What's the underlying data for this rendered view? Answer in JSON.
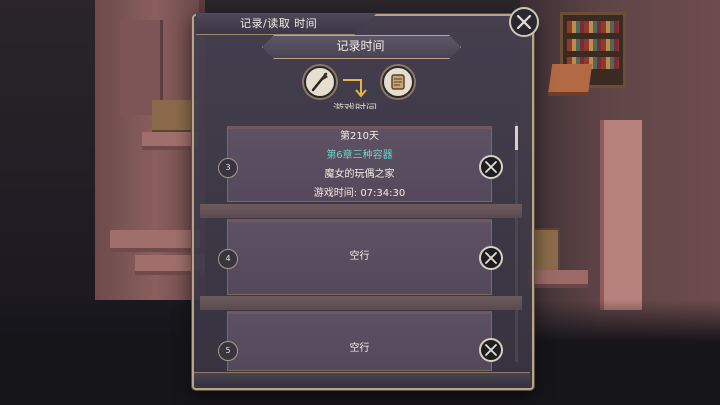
{
  "dialog": {
    "title": "记录/读取 时间",
    "header": "记录时间",
    "mode_label": "游戏时间"
  },
  "mode_icons": {
    "save": "quill-icon",
    "load": "scroll-icon"
  },
  "slots": [
    {
      "number": "3",
      "day": "第210天",
      "chapter": "第6章三种容器",
      "location": "魔女的玩偶之家",
      "play_time": "游戏时间:   07:34:30"
    },
    {
      "number": "4",
      "status": "空行"
    },
    {
      "number": "5",
      "status": "空行"
    }
  ],
  "colors": {
    "panel": "#433d4d",
    "border": "#b9a489",
    "chapter_text": "#6fd1c8",
    "text": "#f2ede4"
  }
}
